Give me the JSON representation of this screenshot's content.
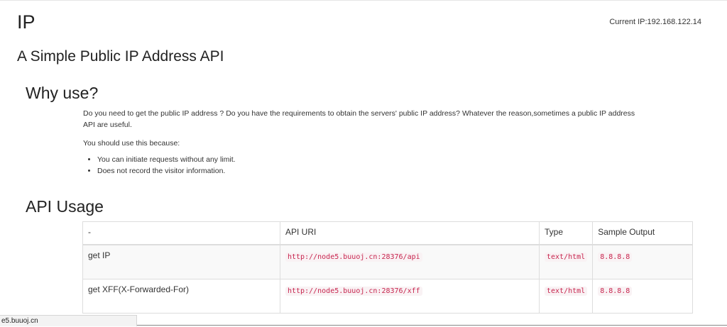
{
  "header": {
    "brand": "IP",
    "current_ip_label": "Current IP:",
    "current_ip_value": "192.168.122.14"
  },
  "page_title": "A Simple Public IP Address API",
  "why_use": {
    "heading": "Why use?",
    "paragraph": "Do you need to get the public IP address ? Do you have the requirements to obtain the servers' public IP address? Whatever the reason,sometimes a public IP address API are useful.",
    "intro": "You should use this because:",
    "reasons": [
      "You can initiate requests without any limit.",
      "Does not record the visitor information."
    ]
  },
  "api_usage": {
    "heading": "API Usage",
    "columns": [
      "-",
      "API URI",
      "Type",
      "Sample Output"
    ],
    "rows": [
      {
        "name": "get IP",
        "uri": "http://node5.buuoj.cn:28376/api",
        "type": "text/html",
        "sample": "8.8.8.8"
      },
      {
        "name": "get XFF(X-Forwarded-For)",
        "uri": "http://node5.buuoj.cn:28376/xff",
        "type": "text/html",
        "sample": "8.8.8.8"
      }
    ]
  },
  "status_bar": {
    "text": "e5.buuoj.cn"
  }
}
